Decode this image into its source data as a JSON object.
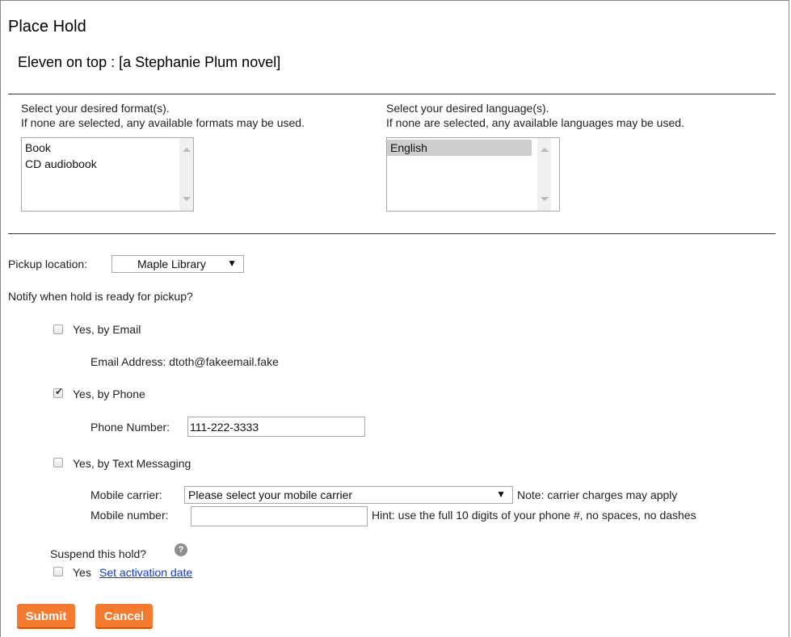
{
  "page": {
    "title": "Place Hold",
    "item_title": "Eleven on top : [a Stephanie Plum novel]"
  },
  "format": {
    "line1": "Select your desired format(s).",
    "line2": "If none are selected, any available formats may be used.",
    "options": [
      "Book",
      "CD audiobook"
    ]
  },
  "language": {
    "line1": "Select your desired language(s).",
    "line2": "If none are selected, any available languages may be used.",
    "options": [
      "English"
    ]
  },
  "pickup": {
    "label": "Pickup location:",
    "value": "Maple Library"
  },
  "notify": {
    "question": "Notify when hold is ready for pickup?",
    "email": {
      "label": "Yes, by Email",
      "checked": false,
      "address_label": "Email Address: dtoth@fakeemail.fake"
    },
    "phone": {
      "label": "Yes, by Phone",
      "checked": true,
      "number_label": "Phone Number:",
      "number_value": "111-222-3333"
    },
    "text": {
      "label": "Yes, by Text Messaging",
      "checked": false,
      "carrier_label": "Mobile carrier:",
      "carrier_value": "Please select your mobile carrier",
      "carrier_note": "Note: carrier charges may apply",
      "number_label": "Mobile number:",
      "number_value": "",
      "number_hint": "Hint: use the full 10 digits of your phone #, no spaces, no dashes"
    }
  },
  "suspend": {
    "question": "Suspend this hold?",
    "help_icon": "?",
    "yes_label": "Yes",
    "activation_link": "Set activation date"
  },
  "buttons": {
    "submit": "Submit",
    "cancel": "Cancel"
  },
  "colors": {
    "button_bg": "#f37a2e",
    "link": "#0b39d6"
  }
}
